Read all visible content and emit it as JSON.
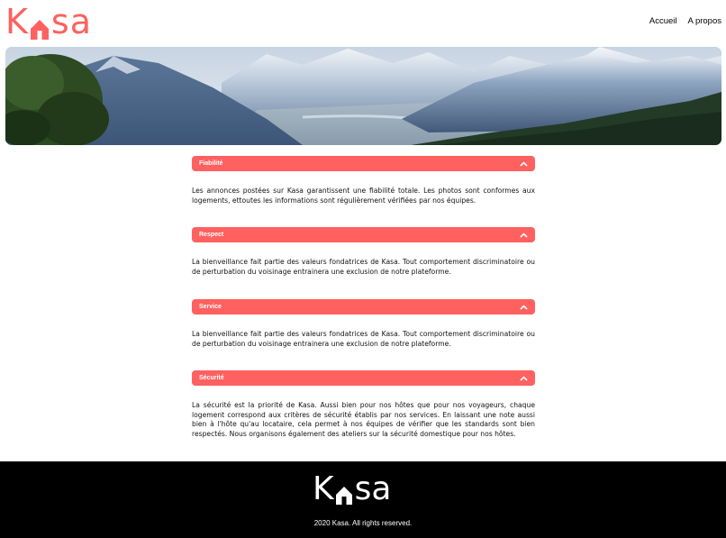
{
  "header": {
    "logo": {
      "first": "K",
      "rest": "sa",
      "icon": "house-icon",
      "color": "#ff6060"
    },
    "nav": [
      {
        "label": "Accueil"
      },
      {
        "label": "A propos"
      }
    ]
  },
  "banner": {
    "image": "mountain-landscape"
  },
  "about": {
    "items": [
      {
        "title": "Fiabilité",
        "text": "Les annonces postées sur Kasa garantissent une fiabilité totale. Les photos sont conformes aux logements, ettoutes les informations sont régulièrement vérifiées par nos équipes."
      },
      {
        "title": "Respect",
        "text": "La bienveillance fait partie des valeurs fondatrices de Kasa. Tout comportement discriminatoire ou de perturbation du voisinage entrainera une exclusion de notre plateforme."
      },
      {
        "title": "Service",
        "text": "La bienveillance fait partie des valeurs fondatrices de Kasa. Tout comportement discriminatoire ou de perturbation du voisinage entrainera une exclusion de notre plateforme."
      },
      {
        "title": "Sécurité",
        "text": "La sécurité est la priorité de Kasa. Aussi bien pour nos hôtes que pour nos voyageurs, chaque logement correspond aux critères de sécurité établis par nos services. En laissant une note aussi bien à l'hôte qu'au locataire, cela permet à nos équipes de vérifier que les standards sont bien respectés. Nous organisons également des ateliers sur la sécurité domestique pour nos hôtes."
      }
    ],
    "accent": "#ff6060"
  },
  "footer": {
    "logo": {
      "first": "K",
      "rest": "sa",
      "icon": "house-icon"
    },
    "copyright": "2020 Kasa. All rights reserved."
  }
}
